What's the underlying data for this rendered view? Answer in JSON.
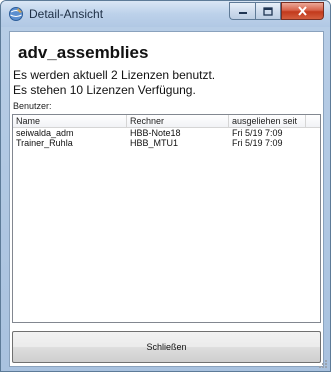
{
  "window": {
    "title": "Detail-Ansicht",
    "icon": "globe-app-icon",
    "controls": [
      "minimize-icon",
      "maximize-icon",
      "close-icon"
    ]
  },
  "content": {
    "heading": "adv_assemblies",
    "line1": "Es werden aktuell 2 Lizenzen benutzt.",
    "line2": "Es stehen  10 Lizenzen Verfügung.",
    "users_label": "Benutzer:"
  },
  "table": {
    "columns": [
      "Name",
      "Rechner",
      "ausgeliehen seit"
    ],
    "rows": [
      [
        "seiwalda_adm",
        "HBB-Note18",
        "Fri 5/19 7:09"
      ],
      [
        "Trainer_Ruhla",
        "HBB_MTU1",
        "Fri 5/19 7:09"
      ]
    ]
  },
  "buttons": {
    "close_label": "Schließen"
  }
}
